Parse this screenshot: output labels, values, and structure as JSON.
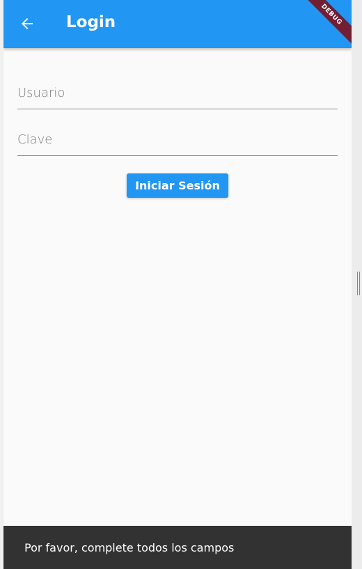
{
  "appbar": {
    "title": "Login",
    "back_icon": "arrow-left-icon",
    "color": "#2196f3"
  },
  "debug_banner": "DEBUG",
  "form": {
    "user_placeholder": "Usuario",
    "password_placeholder": "Clave",
    "submit_label": "Iniciar Sesión"
  },
  "snackbar": {
    "message": "Por favor, complete todos los campos"
  }
}
